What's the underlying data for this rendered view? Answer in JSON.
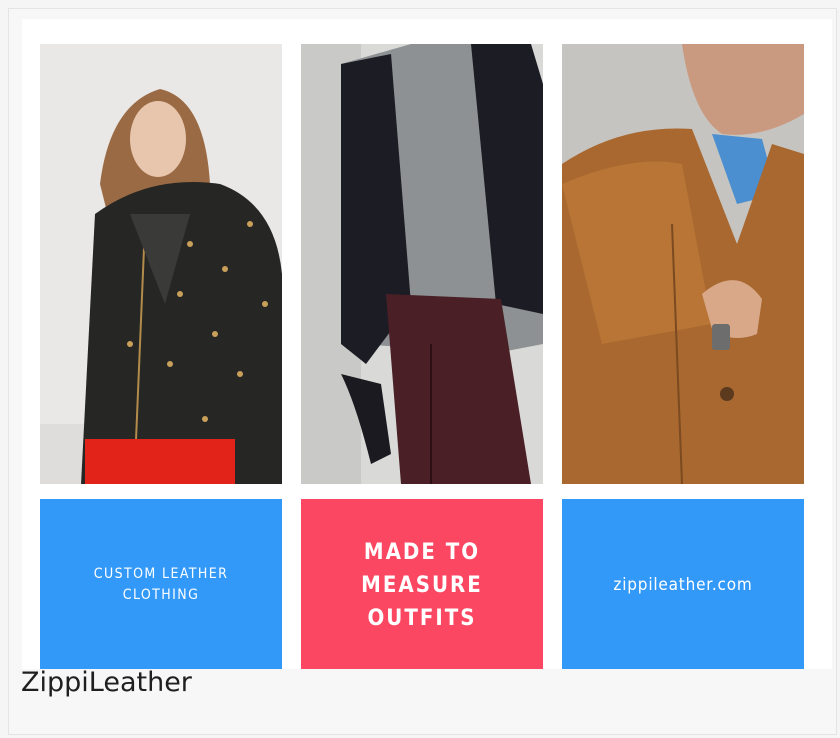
{
  "tiles": {
    "left": "CUSTOM LEATHER CLOTHING",
    "center": "MADE TO MEASURE OUTFITS",
    "right": "zippileather.com"
  },
  "caption": "ZippiLeather",
  "colors": {
    "blue": "#3399f9",
    "pink": "#fc4762"
  }
}
